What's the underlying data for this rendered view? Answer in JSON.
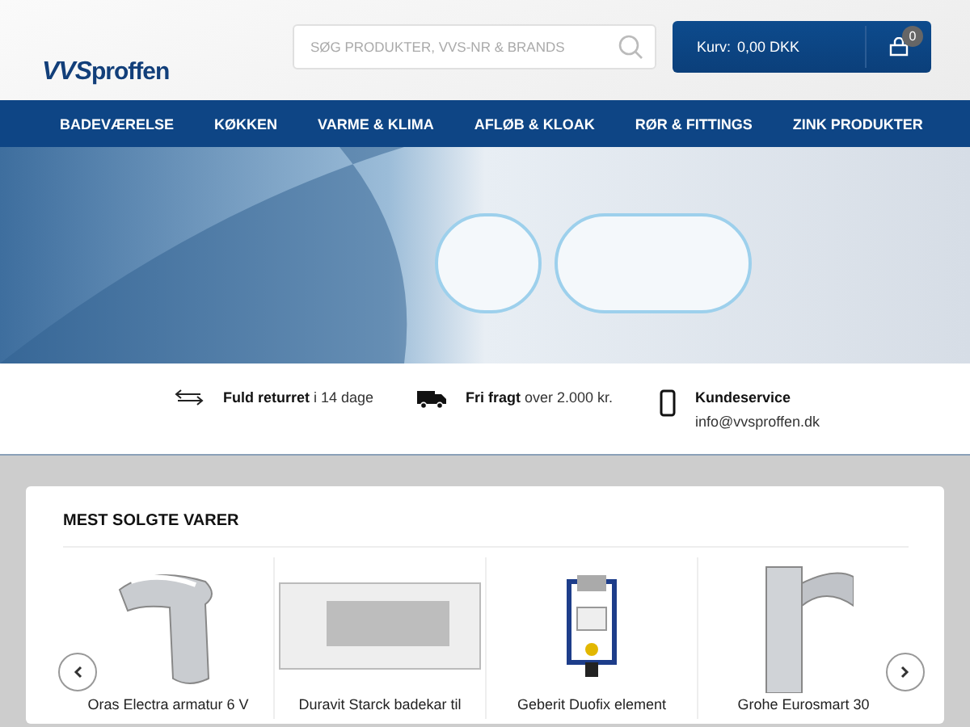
{
  "header": {
    "logo": {
      "brand_a": "VVS",
      "brand_b": "proffen"
    },
    "search": {
      "placeholder": "SØG PRODUKTER, VVS-NR & BRANDS"
    },
    "cart": {
      "label": "Kurv:",
      "amount": "0,00 DKK",
      "count": "0"
    }
  },
  "nav": {
    "items": [
      {
        "label": "BADEVÆRELSE"
      },
      {
        "label": "KØKKEN"
      },
      {
        "label": "VARME & KLIMA"
      },
      {
        "label": "AFLØB & KLOAK"
      },
      {
        "label": "RØR & FITTINGS"
      },
      {
        "label": "ZINK PRODUKTER"
      }
    ]
  },
  "usps": [
    {
      "kind": "return",
      "title": "Fuld returret",
      "text": "i 14 dage"
    },
    {
      "kind": "truck",
      "title": "Fri fragt",
      "text": "over 2.000 kr."
    },
    {
      "kind": "phone",
      "title": "Kundeservice",
      "text": "info@vvsproffen.dk"
    }
  ],
  "bestsellers": {
    "title": "MEST SOLGTE VARER",
    "products": [
      {
        "kind": "tap",
        "name": "Oras Electra armatur 6 V"
      },
      {
        "kind": "bathtub",
        "name": "Duravit Starck badekar til"
      },
      {
        "kind": "frame",
        "name": "Geberit Duofix element"
      },
      {
        "kind": "mixer",
        "name": "Grohe Eurosmart 30"
      }
    ]
  }
}
